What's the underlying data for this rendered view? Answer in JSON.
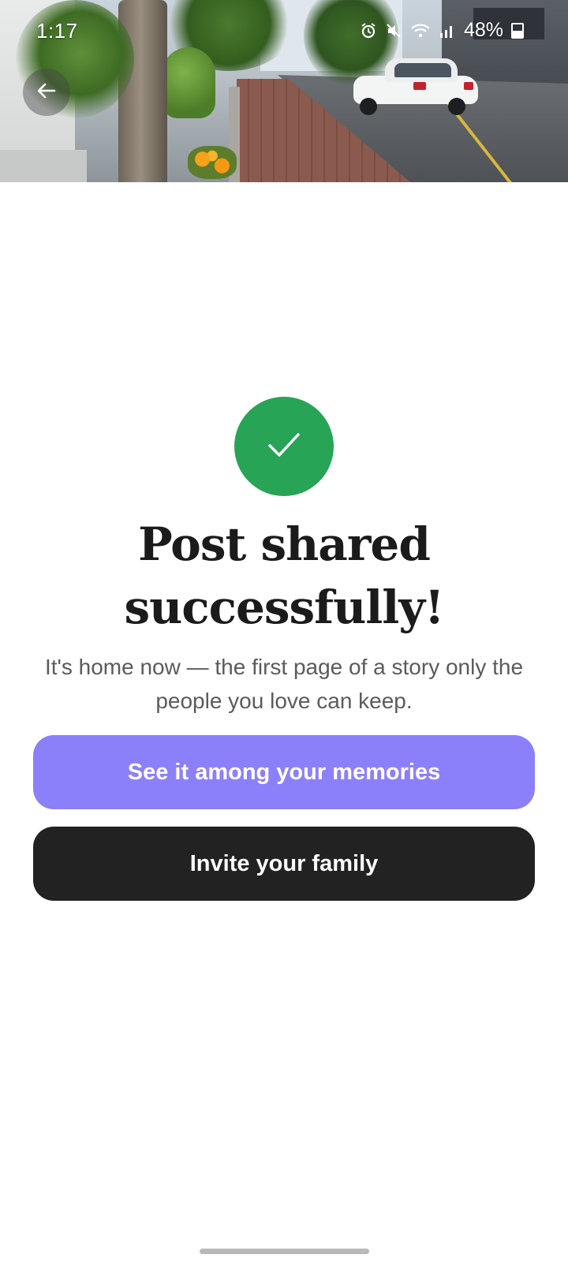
{
  "status_bar": {
    "time": "1:17",
    "battery_percent": "48%",
    "icons": [
      "alarm-icon",
      "mute-icon",
      "wifi-icon",
      "signal-icon",
      "battery-icon"
    ],
    "battery_level": 0.48
  },
  "header": {
    "back_icon": "arrow-left-icon",
    "hero_image": "street-photo"
  },
  "main": {
    "success_icon": "checkmark-icon",
    "title": "Post shared successfully!",
    "subtitle": "It's home now — the first page of a story only the people you love can keep.",
    "primary_button_label": "See it among your memories",
    "secondary_button_label": "Invite your family"
  },
  "colors": {
    "success": "#27a456",
    "primary_button": "#8c80fa",
    "secondary_button": "#222222",
    "title_text": "#1b1b1b",
    "body_text": "#5b5b5b"
  }
}
